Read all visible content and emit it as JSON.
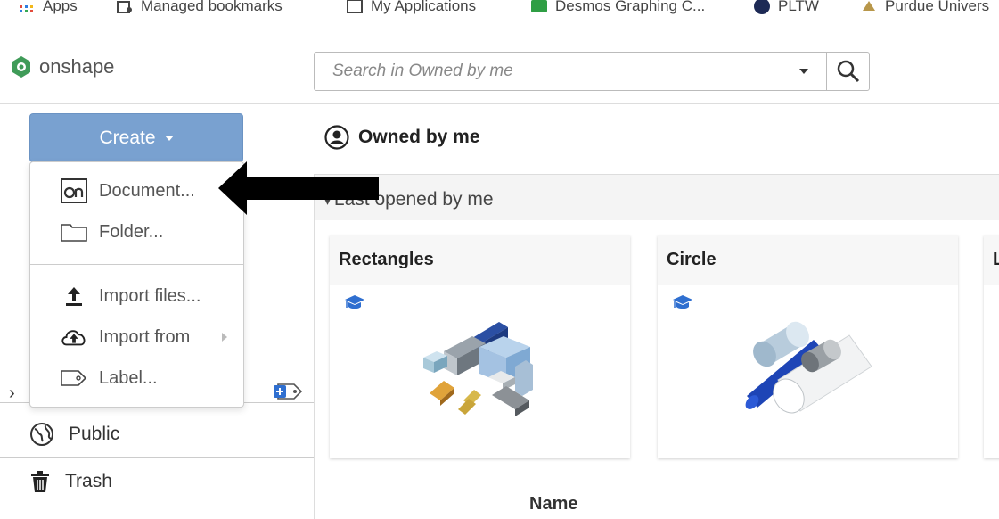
{
  "bookmarks": [
    {
      "label": "Apps",
      "icon": "apps-grid-icon"
    },
    {
      "label": "Managed bookmarks",
      "icon": "managed-bookmarks-icon"
    },
    {
      "label": "My Applications",
      "icon": "page-icon"
    },
    {
      "label": "Desmos Graphing C...",
      "icon": "desmos-icon"
    },
    {
      "label": "PLTW",
      "icon": "pltw-icon"
    },
    {
      "label": "Purdue Univers",
      "icon": "purdue-icon"
    }
  ],
  "header": {
    "logo_text": "onshape",
    "search_placeholder": "Search in Owned by me"
  },
  "sidebar": {
    "create_label": "Create",
    "items": [
      {
        "label": "Public",
        "icon": "globe-icon"
      },
      {
        "label": "Trash",
        "icon": "trash-icon"
      }
    ]
  },
  "create_menu": {
    "items": [
      {
        "label": "Document...",
        "icon": "onshape-document-icon"
      },
      {
        "label": "Folder...",
        "icon": "folder-icon"
      },
      {
        "label": "Import files...",
        "icon": "upload-icon"
      },
      {
        "label": "Import from",
        "icon": "cloud-upload-icon",
        "has_submenu": true
      },
      {
        "label": "Label...",
        "icon": "label-icon"
      }
    ]
  },
  "main": {
    "title": "Owned by me",
    "section_label": "Last opened by me",
    "cards": [
      {
        "title": "Rectangles",
        "badge": "education-cap-icon"
      },
      {
        "title": "Circle",
        "badge": "education-cap-icon"
      },
      {
        "title": "L",
        "badge": ""
      }
    ],
    "column_header": "Name"
  },
  "colors": {
    "create_button": "#79a1d0",
    "edu_badge": "#2f6fd0",
    "arrow": "#000000"
  }
}
